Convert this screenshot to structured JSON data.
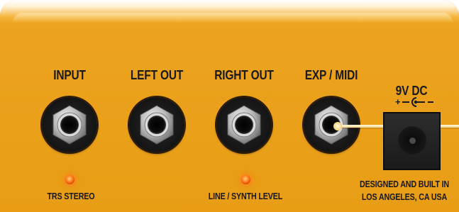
{
  "jacks": [
    {
      "label": "INPUT"
    },
    {
      "label": "LEFT OUT"
    },
    {
      "label": "RIGHT OUT"
    },
    {
      "label": "EXP / MIDI"
    }
  ],
  "power": {
    "label": "9V DC",
    "polarity_icon": "center-negative-polarity-icon"
  },
  "leds": [
    {
      "caption": "TRS STEREO",
      "color": "#ff7a18"
    },
    {
      "caption": "LINE / SYNTH LEVEL",
      "color": "#ff7a18"
    }
  ],
  "credit": {
    "line1": "DESIGNED AND BUILT IN",
    "line2": "LOS ANGELES, CA USA"
  },
  "colors": {
    "panel": "#e89d15",
    "text": "#1a1a1a",
    "jack_nut": "#c9c9c9"
  }
}
